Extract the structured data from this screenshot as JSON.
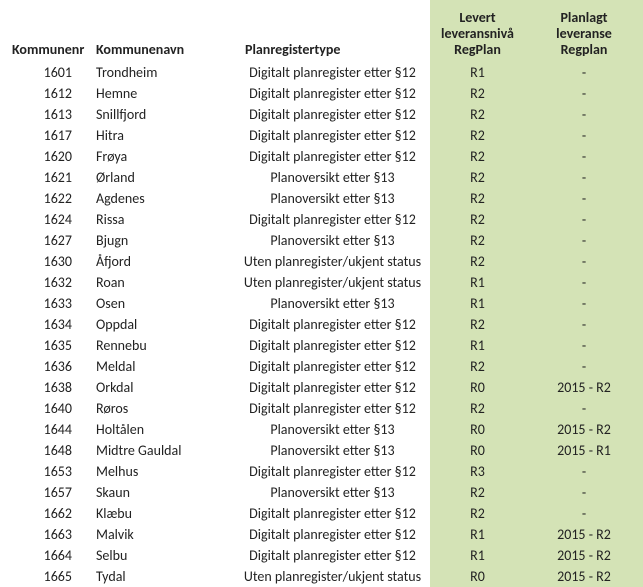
{
  "headers": {
    "kommunenr": "Kommunenr",
    "kommunenavn": "Kommunenavn",
    "planregistertype": "Planregistertype",
    "levert_line1": "Levert",
    "levert_line2": "leveransnivå",
    "levert_line3": "RegPlan",
    "planlagt_line1": "Planlagt",
    "planlagt_line2": "leveranse",
    "planlagt_line3": "Regplan"
  },
  "rows": [
    {
      "nr": "1601",
      "navn": "Trondheim",
      "type": "Digitalt planregister etter §12",
      "levert": "R1",
      "planlagt": "-"
    },
    {
      "nr": "1612",
      "navn": "Hemne",
      "type": "Digitalt planregister etter §12",
      "levert": "R2",
      "planlagt": "-"
    },
    {
      "nr": "1613",
      "navn": "Snillfjord",
      "type": "Digitalt planregister etter §12",
      "levert": "R2",
      "planlagt": "-"
    },
    {
      "nr": "1617",
      "navn": "Hitra",
      "type": "Digitalt planregister etter §12",
      "levert": "R2",
      "planlagt": "-"
    },
    {
      "nr": "1620",
      "navn": "Frøya",
      "type": "Digitalt planregister etter §12",
      "levert": "R2",
      "planlagt": "-"
    },
    {
      "nr": "1621",
      "navn": "Ørland",
      "type": "Planoversikt etter §13",
      "levert": "R2",
      "planlagt": "-"
    },
    {
      "nr": "1622",
      "navn": "Agdenes",
      "type": "Planoversikt etter §13",
      "levert": "R2",
      "planlagt": "-"
    },
    {
      "nr": "1624",
      "navn": "Rissa",
      "type": "Digitalt planregister etter §12",
      "levert": "R2",
      "planlagt": "-"
    },
    {
      "nr": "1627",
      "navn": "Bjugn",
      "type": "Planoversikt etter §13",
      "levert": "R2",
      "planlagt": "-"
    },
    {
      "nr": "1630",
      "navn": "Åfjord",
      "type": "Uten planregister/ukjent status",
      "levert": "R2",
      "planlagt": "-"
    },
    {
      "nr": "1632",
      "navn": "Roan",
      "type": "Uten planregister/ukjent status",
      "levert": "R1",
      "planlagt": "-"
    },
    {
      "nr": "1633",
      "navn": "Osen",
      "type": "Planoversikt etter §13",
      "levert": "R1",
      "planlagt": "-"
    },
    {
      "nr": "1634",
      "navn": "Oppdal",
      "type": "Digitalt planregister etter §12",
      "levert": "R2",
      "planlagt": "-"
    },
    {
      "nr": "1635",
      "navn": "Rennebu",
      "type": "Digitalt planregister etter §12",
      "levert": "R1",
      "planlagt": "-"
    },
    {
      "nr": "1636",
      "navn": "Meldal",
      "type": "Digitalt planregister etter §12",
      "levert": "R2",
      "planlagt": "-"
    },
    {
      "nr": "1638",
      "navn": "Orkdal",
      "type": "Digitalt planregister etter §12",
      "levert": "R0",
      "planlagt": "2015 -  R2"
    },
    {
      "nr": "1640",
      "navn": "Røros",
      "type": "Digitalt planregister etter §12",
      "levert": "R2",
      "planlagt": "-"
    },
    {
      "nr": "1644",
      "navn": "Holtålen",
      "type": "Planoversikt etter §13",
      "levert": "R0",
      "planlagt": "2015 -  R2"
    },
    {
      "nr": "1648",
      "navn": "Midtre Gauldal",
      "type": "Planoversikt etter §13",
      "levert": "R0",
      "planlagt": "2015 -  R1"
    },
    {
      "nr": "1653",
      "navn": "Melhus",
      "type": "Digitalt planregister etter §12",
      "levert": "R3",
      "planlagt": "-"
    },
    {
      "nr": "1657",
      "navn": "Skaun",
      "type": "Planoversikt etter §13",
      "levert": "R2",
      "planlagt": "-"
    },
    {
      "nr": "1662",
      "navn": "Klæbu",
      "type": "Digitalt planregister etter §12",
      "levert": "R2",
      "planlagt": "-"
    },
    {
      "nr": "1663",
      "navn": "Malvik",
      "type": "Digitalt planregister etter §12",
      "levert": "R1",
      "planlagt": "2015 -  R2"
    },
    {
      "nr": "1664",
      "navn": "Selbu",
      "type": "Digitalt planregister etter §12",
      "levert": "R1",
      "planlagt": "2015 -  R2"
    },
    {
      "nr": "1665",
      "navn": "Tydal",
      "type": "Uten planregister/ukjent status",
      "levert": "R0",
      "planlagt": "2015 -  R2"
    }
  ]
}
